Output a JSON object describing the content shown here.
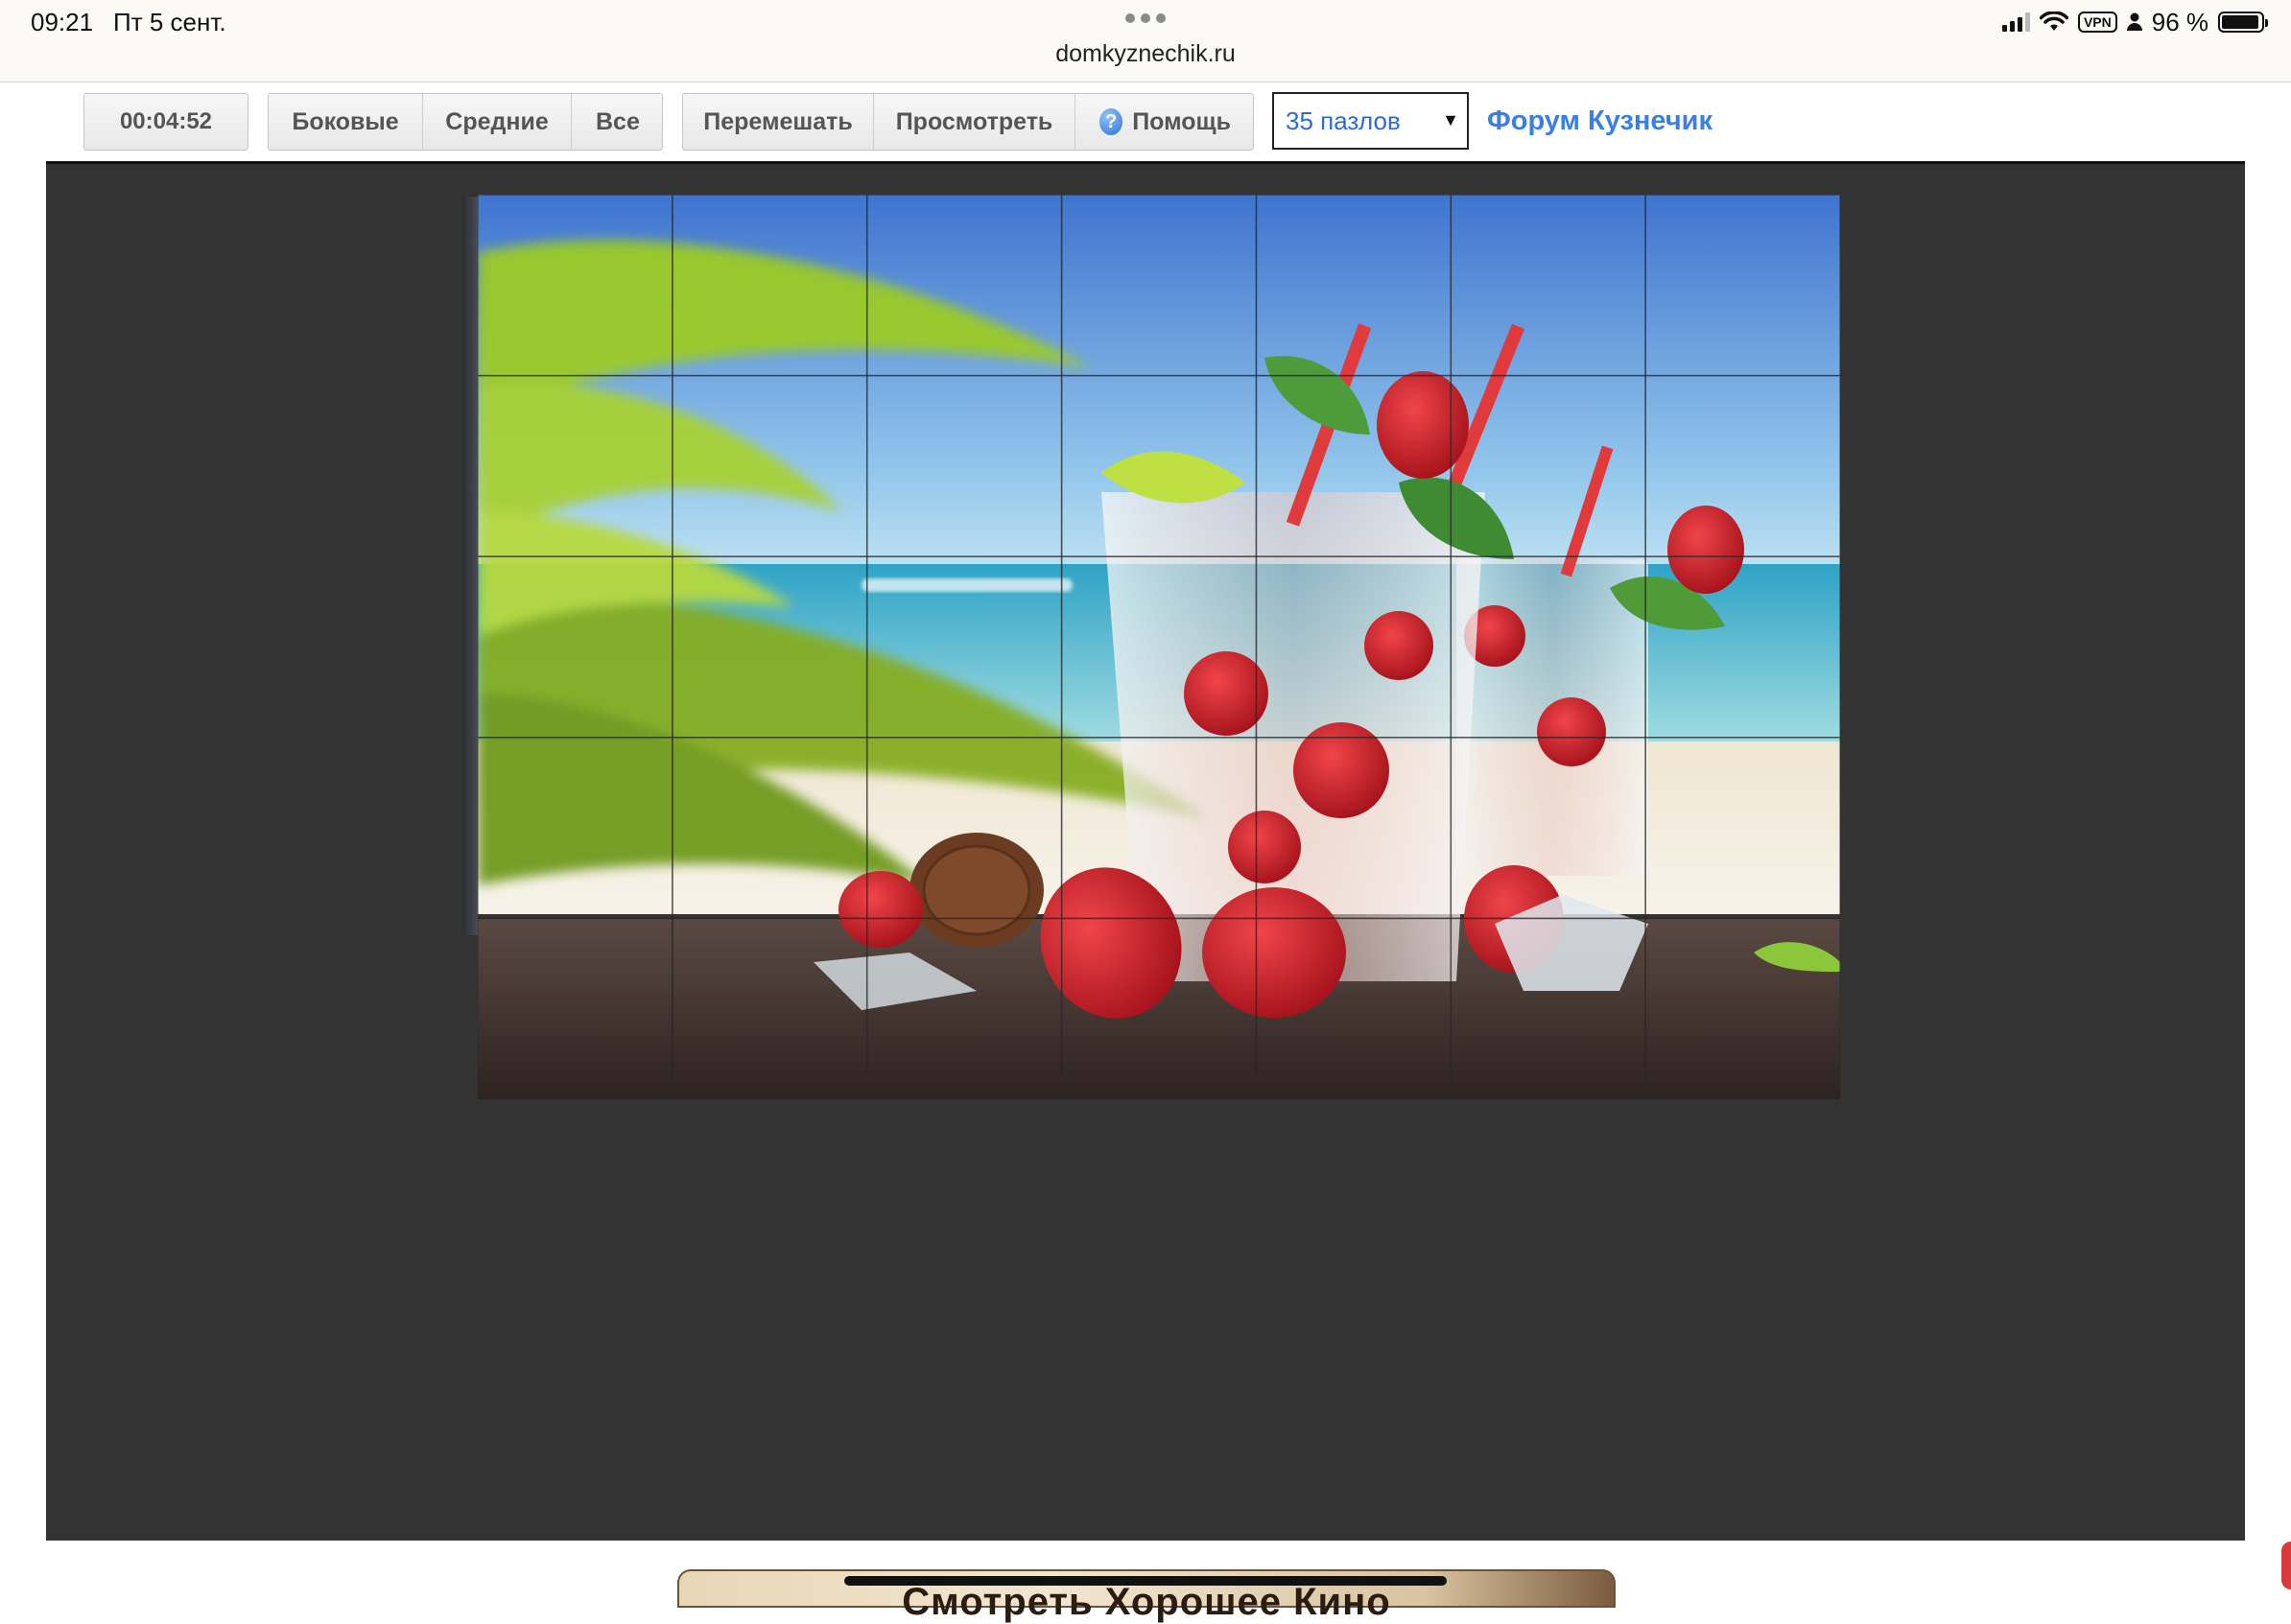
{
  "status_bar": {
    "time": "09:21",
    "date": "Пт 5 сент.",
    "url": "domkyznechik.ru",
    "vpn": "VPN",
    "battery": "96 %",
    "battery_level": 0.96
  },
  "toolbar": {
    "timer": "00:04:52",
    "filters": [
      "Боковые",
      "Средние",
      "Все"
    ],
    "actions": {
      "shuffle": "Перемешать",
      "preview": "Просмотреть",
      "help": "Помощь",
      "help_icon": "?"
    },
    "piece_count_select": {
      "selected": "35 пазлов"
    },
    "forum_link": "Форум Кузнечик"
  },
  "puzzle": {
    "rows": 5,
    "cols": 7,
    "picture": "strawberry-mojito-beach-image",
    "colors": {
      "sky": "#4f86d6",
      "sea": "#5dc3d6",
      "table": "#4a3a35",
      "leaf": "#8fbf2a",
      "berry": "#d9262b"
    }
  },
  "ad": {
    "text": "Смотреть Хорошее Кино"
  }
}
